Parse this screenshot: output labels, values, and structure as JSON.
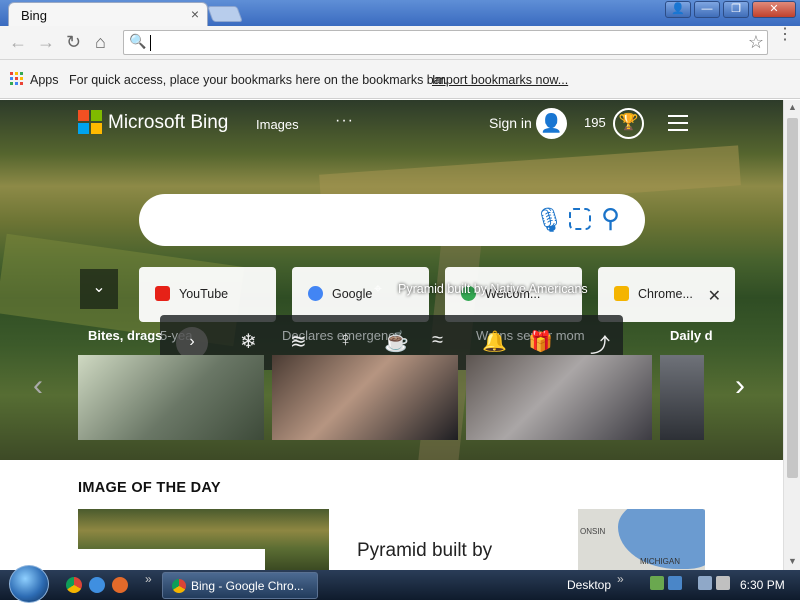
{
  "browser": {
    "tab_title": "Bing",
    "tab_close": "×",
    "window_buttons": {
      "user": "👤",
      "minimize": "—",
      "restore": "❐",
      "close": "✕"
    },
    "nav": {
      "back": "←",
      "forward": "→",
      "reload": "↻",
      "home": "⌂"
    },
    "omnibox": {
      "value": "",
      "placeholder": ""
    },
    "star": "☆",
    "menu": "⋮"
  },
  "bookmarks_bar": {
    "apps_label": "Apps",
    "message": "For quick access, place your bookmarks here on the bookmarks bar.",
    "import_link": "Import bookmarks now..."
  },
  "bing": {
    "brand": "Microsoft Bing",
    "images_link": "Images",
    "more": "···",
    "sign_in": "Sign in",
    "points": "195",
    "search_placeholder": "",
    "expand": "⌄",
    "sites": [
      {
        "label": "YouTube",
        "color": "#e62117"
      },
      {
        "label": "Google",
        "color": "#4285f4"
      },
      {
        "label": "Welcom...",
        "color": "#34a853"
      },
      {
        "label": "Chrome...",
        "color": "#f4b400",
        "close": "✕"
      }
    ],
    "overlay_caption": "Pyramid built by Native Americans",
    "news_caption_1": "Bites, drags",
    "news_caption_1_faded": "5-yea",
    "news_caption_2_faded": "Declares emergency",
    "news_caption_3_faded": "Warns senior mom",
    "news_caption_4": "Daily d",
    "bar_icons": [
      "›",
      "❄",
      "≋",
      "♀",
      "☕",
      "≈",
      "🔔",
      "🎁",
      "⤴"
    ],
    "arrow_left": "‹",
    "arrow_right": "›",
    "image_of_the_day_title": "IMAGE OF THE DAY",
    "iotd_caption": "Pyramid built by",
    "map_labels": [
      "ONSIN",
      "MICHIGAN"
    ]
  },
  "taskbar": {
    "task_label": "Bing - Google Chro...",
    "desktop_label": "Desktop",
    "more_chev": "»",
    "clock": "6:30 PM"
  },
  "colors": {
    "logo_red": "#f25022",
    "logo_green": "#7fba00",
    "logo_blue": "#00a4ef",
    "logo_yellow": "#ffb900",
    "bing_blue": "#1a73c9"
  }
}
